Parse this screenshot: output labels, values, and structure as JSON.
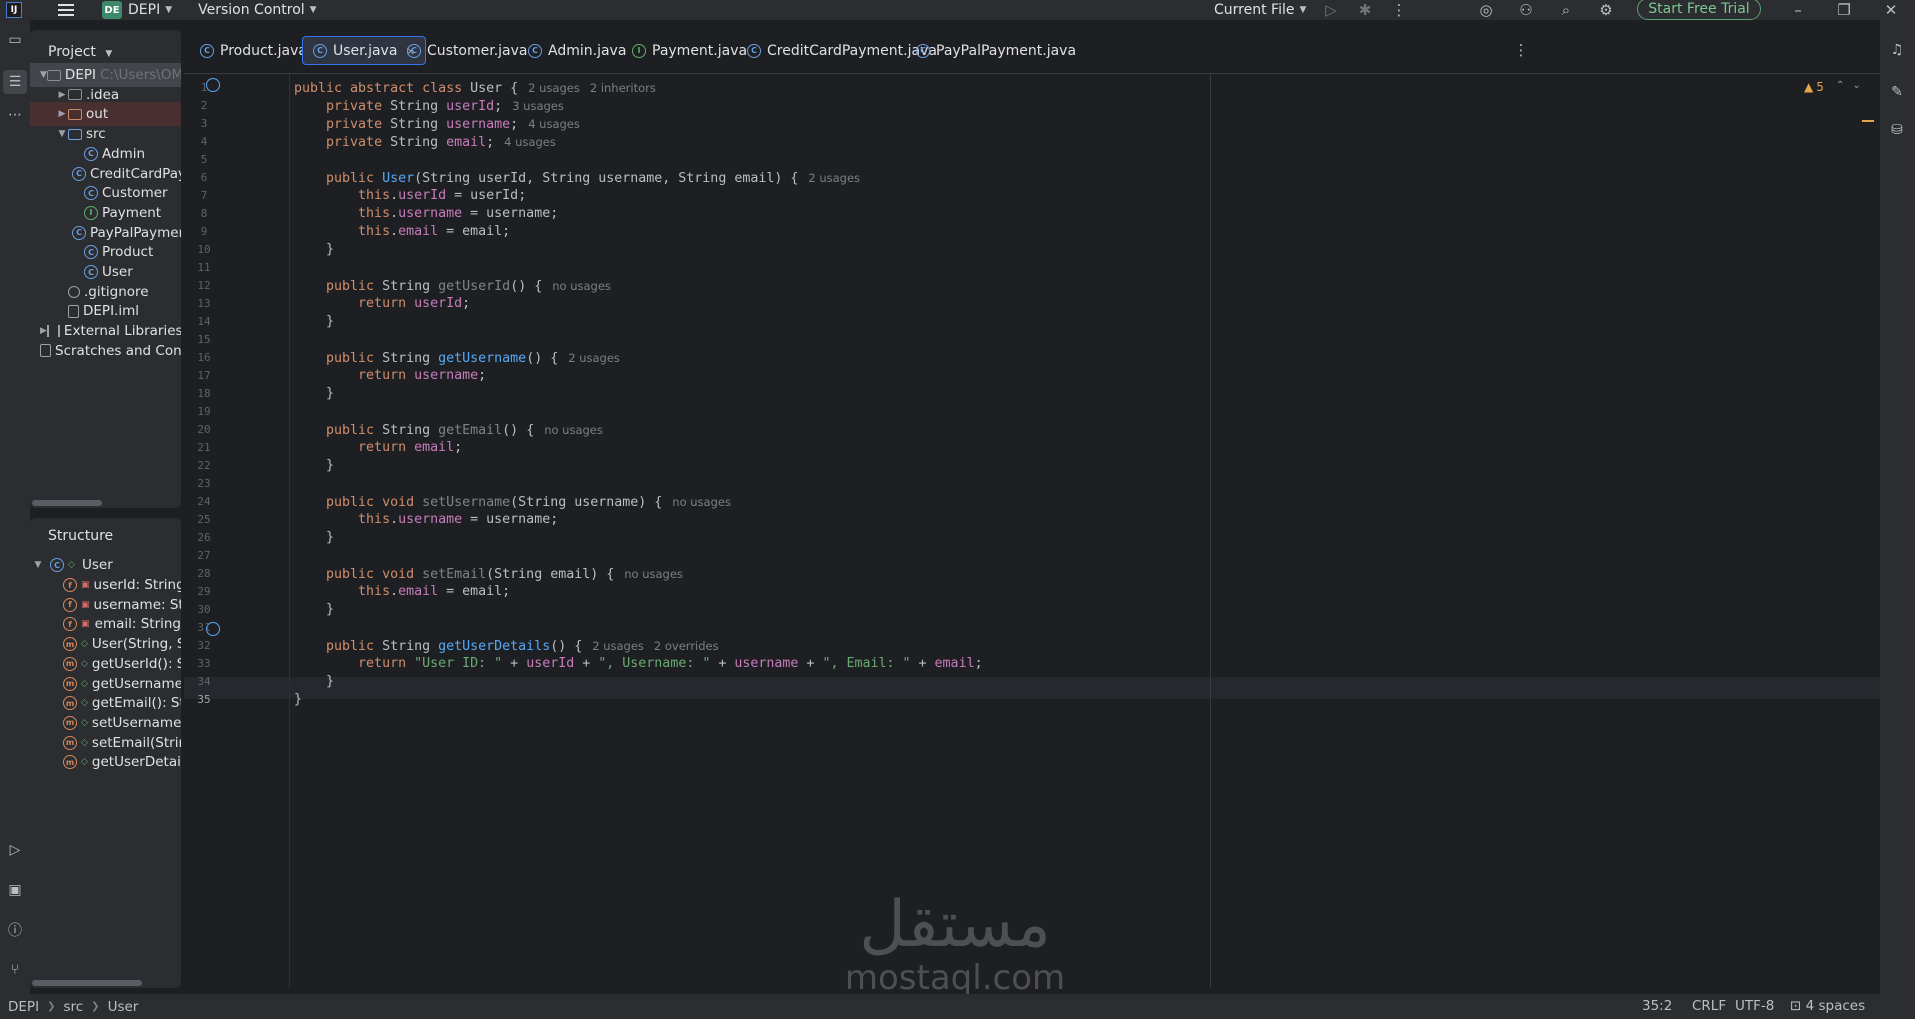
{
  "titlebar": {
    "project_badge": "DE",
    "project_name": "DEPI",
    "version_control": "Version Control",
    "run_config": "Current File",
    "trial_button": "Start Free Trial"
  },
  "project_panel": {
    "title": "Project",
    "tree": [
      {
        "label": "DEPI",
        "hint": "C:\\Users\\OMAR",
        "icon": "module-folder-icon",
        "depth": 0,
        "arrow": "expanded",
        "state": "selected"
      },
      {
        "label": ".idea",
        "icon": "folder-icon",
        "depth": 1,
        "arrow": "collapsed"
      },
      {
        "label": "out",
        "icon": "folder-icon",
        "depth": 1,
        "arrow": "collapsed",
        "state": "excluded"
      },
      {
        "label": "src",
        "icon": "source-folder-icon",
        "depth": 1,
        "arrow": "expanded"
      },
      {
        "label": "Admin",
        "icon": "class-icon",
        "depth": 2
      },
      {
        "label": "CreditCardPaym",
        "icon": "class-icon",
        "depth": 2
      },
      {
        "label": "Customer",
        "icon": "class-icon",
        "depth": 2
      },
      {
        "label": "Payment",
        "icon": "interface-icon",
        "depth": 2
      },
      {
        "label": "PayPalPayment",
        "icon": "class-icon",
        "depth": 2
      },
      {
        "label": "Product",
        "icon": "class-icon",
        "depth": 2
      },
      {
        "label": "User",
        "icon": "class-icon",
        "depth": 2
      },
      {
        "label": ".gitignore",
        "icon": "ignore-file-icon",
        "depth": 1
      },
      {
        "label": "DEPI.iml",
        "icon": "file-icon",
        "depth": 1
      },
      {
        "label": "External Libraries",
        "icon": "library-icon",
        "depth": 0,
        "arrow": "collapsed"
      },
      {
        "label": "Scratches and Conso",
        "icon": "scratches-icon",
        "depth": 0
      }
    ]
  },
  "structure_panel": {
    "title": "Structure",
    "root": "User",
    "members": [
      {
        "label": "userId: String",
        "kind": "f",
        "access": "private"
      },
      {
        "label": "username: String",
        "kind": "f",
        "access": "private"
      },
      {
        "label": "email: String",
        "kind": "f",
        "access": "private"
      },
      {
        "label": "User(String, Strin",
        "kind": "m",
        "access": "public"
      },
      {
        "label": "getUserId(): Strin",
        "kind": "m",
        "access": "public"
      },
      {
        "label": "getUsername(): S",
        "kind": "m",
        "access": "public"
      },
      {
        "label": "getEmail(): String",
        "kind": "m",
        "access": "public"
      },
      {
        "label": "setUsername(Stri",
        "kind": "m",
        "access": "public"
      },
      {
        "label": "setEmail(String): ",
        "kind": "m",
        "access": "public"
      },
      {
        "label": "getUserDetails():",
        "kind": "m",
        "access": "public"
      }
    ]
  },
  "tabs": [
    {
      "label": "Product.java",
      "icon": "class-icon",
      "active": false
    },
    {
      "label": "User.java",
      "icon": "class-icon",
      "active": true
    },
    {
      "label": "Customer.java",
      "icon": "class-icon",
      "active": false
    },
    {
      "label": "Admin.java",
      "icon": "class-icon",
      "active": false
    },
    {
      "label": "Payment.java",
      "icon": "interface-icon",
      "active": false
    },
    {
      "label": "CreditCardPayment.java",
      "icon": "class-icon",
      "active": false
    },
    {
      "label": "PayPalPayment.java",
      "icon": "class-icon",
      "active": false
    }
  ],
  "editor": {
    "warnings_count": "5",
    "current_line": 35,
    "lines": [
      [
        [
          "kw",
          "public abstract class "
        ],
        [
          "t",
          "User "
        ],
        [
          "t",
          "{"
        ],
        [
          "hint",
          "2 usages"
        ],
        [
          "hint",
          "2 inheritors"
        ]
      ],
      [
        [
          "t",
          "    "
        ],
        [
          "kw",
          "private "
        ],
        [
          "t",
          "String "
        ],
        [
          "fld",
          "userId"
        ],
        [
          "t",
          ";"
        ],
        [
          "hint",
          "3 usages"
        ]
      ],
      [
        [
          "t",
          "    "
        ],
        [
          "kw",
          "private "
        ],
        [
          "t",
          "String "
        ],
        [
          "fld",
          "username"
        ],
        [
          "t",
          ";"
        ],
        [
          "hint",
          "4 usages"
        ]
      ],
      [
        [
          "t",
          "    "
        ],
        [
          "kw",
          "private "
        ],
        [
          "t",
          "String "
        ],
        [
          "fld",
          "email"
        ],
        [
          "t",
          ";"
        ],
        [
          "hint",
          "4 usages"
        ]
      ],
      [],
      [
        [
          "t",
          "    "
        ],
        [
          "kw",
          "public "
        ],
        [
          "fn",
          "User"
        ],
        [
          "t",
          "(String userId, String username, String email) {"
        ],
        [
          "hint",
          "2 usages"
        ]
      ],
      [
        [
          "t",
          "        "
        ],
        [
          "kw",
          "this"
        ],
        [
          "t",
          "."
        ],
        [
          "fld",
          "userId"
        ],
        [
          "t",
          " = userId;"
        ]
      ],
      [
        [
          "t",
          "        "
        ],
        [
          "kw",
          "this"
        ],
        [
          "t",
          "."
        ],
        [
          "fld",
          "username"
        ],
        [
          "t",
          " = username;"
        ]
      ],
      [
        [
          "t",
          "        "
        ],
        [
          "kw",
          "this"
        ],
        [
          "t",
          "."
        ],
        [
          "fld",
          "email"
        ],
        [
          "t",
          " = email;"
        ]
      ],
      [
        [
          "t",
          "    }"
        ]
      ],
      [],
      [
        [
          "t",
          "    "
        ],
        [
          "kw",
          "public "
        ],
        [
          "t",
          "String "
        ],
        [
          "fnd",
          "getUserId"
        ],
        [
          "t",
          "() {"
        ],
        [
          "hint",
          "no usages"
        ]
      ],
      [
        [
          "t",
          "        "
        ],
        [
          "kw",
          "return "
        ],
        [
          "fld",
          "userId"
        ],
        [
          "t",
          ";"
        ]
      ],
      [
        [
          "t",
          "    }"
        ]
      ],
      [],
      [
        [
          "t",
          "    "
        ],
        [
          "kw",
          "public "
        ],
        [
          "t",
          "String "
        ],
        [
          "fn",
          "getUsername"
        ],
        [
          "t",
          "() {"
        ],
        [
          "hint",
          "2 usages"
        ]
      ],
      [
        [
          "t",
          "        "
        ],
        [
          "kw",
          "return "
        ],
        [
          "fld",
          "username"
        ],
        [
          "t",
          ";"
        ]
      ],
      [
        [
          "t",
          "    }"
        ]
      ],
      [],
      [
        [
          "t",
          "    "
        ],
        [
          "kw",
          "public "
        ],
        [
          "t",
          "String "
        ],
        [
          "fnd",
          "getEmail"
        ],
        [
          "t",
          "() {"
        ],
        [
          "hint",
          "no usages"
        ]
      ],
      [
        [
          "t",
          "        "
        ],
        [
          "kw",
          "return "
        ],
        [
          "fld",
          "email"
        ],
        [
          "t",
          ";"
        ]
      ],
      [
        [
          "t",
          "    }"
        ]
      ],
      [],
      [
        [
          "t",
          "    "
        ],
        [
          "kw",
          "public void "
        ],
        [
          "fnd",
          "setUsername"
        ],
        [
          "t",
          "(String username) {"
        ],
        [
          "hint",
          "no usages"
        ]
      ],
      [
        [
          "t",
          "        "
        ],
        [
          "kw",
          "this"
        ],
        [
          "t",
          "."
        ],
        [
          "fld",
          "username"
        ],
        [
          "t",
          " = username;"
        ]
      ],
      [
        [
          "t",
          "    }"
        ]
      ],
      [],
      [
        [
          "t",
          "    "
        ],
        [
          "kw",
          "public void "
        ],
        [
          "fnd",
          "setEmail"
        ],
        [
          "t",
          "(String email) {"
        ],
        [
          "hint",
          "no usages"
        ]
      ],
      [
        [
          "t",
          "        "
        ],
        [
          "kw",
          "this"
        ],
        [
          "t",
          "."
        ],
        [
          "fld",
          "email"
        ],
        [
          "t",
          " = email;"
        ]
      ],
      [
        [
          "t",
          "    }"
        ]
      ],
      [],
      [
        [
          "t",
          "    "
        ],
        [
          "kw",
          "public "
        ],
        [
          "t",
          "String "
        ],
        [
          "fn",
          "getUserDetails"
        ],
        [
          "t",
          "() {"
        ],
        [
          "hint",
          "2 usages"
        ],
        [
          "hint",
          "2 overrides"
        ]
      ],
      [
        [
          "t",
          "        "
        ],
        [
          "kw",
          "return "
        ],
        [
          "str",
          "\"User ID: \""
        ],
        [
          "t",
          " + "
        ],
        [
          "fld",
          "userId"
        ],
        [
          "t",
          " + "
        ],
        [
          "str",
          "\", Username: \""
        ],
        [
          "t",
          " + "
        ],
        [
          "fld",
          "username"
        ],
        [
          "t",
          " + "
        ],
        [
          "str",
          "\", Email: \""
        ],
        [
          "t",
          " + "
        ],
        [
          "fld",
          "email"
        ],
        [
          "t",
          ";"
        ]
      ],
      [
        [
          "t",
          "    }"
        ]
      ],
      [
        [
          "t",
          "}"
        ]
      ]
    ]
  },
  "watermark": {
    "arabic": "مستقل",
    "latin": "mostaql.com"
  },
  "statusbar": {
    "breadcrumbs": [
      "DEPI",
      "src",
      "User"
    ],
    "position": "35:2",
    "line_separator": "CRLF",
    "encoding": "UTF-8",
    "indent": "4 spaces"
  },
  "colors": {
    "background": "#1e1f22",
    "panel": "#2b2d30",
    "accent": "#3574f0",
    "keyword": "#cf8e6d",
    "field": "#c77dbb",
    "function": "#56a8f5",
    "string": "#6aab73",
    "trial_green": "#5aa36f"
  }
}
